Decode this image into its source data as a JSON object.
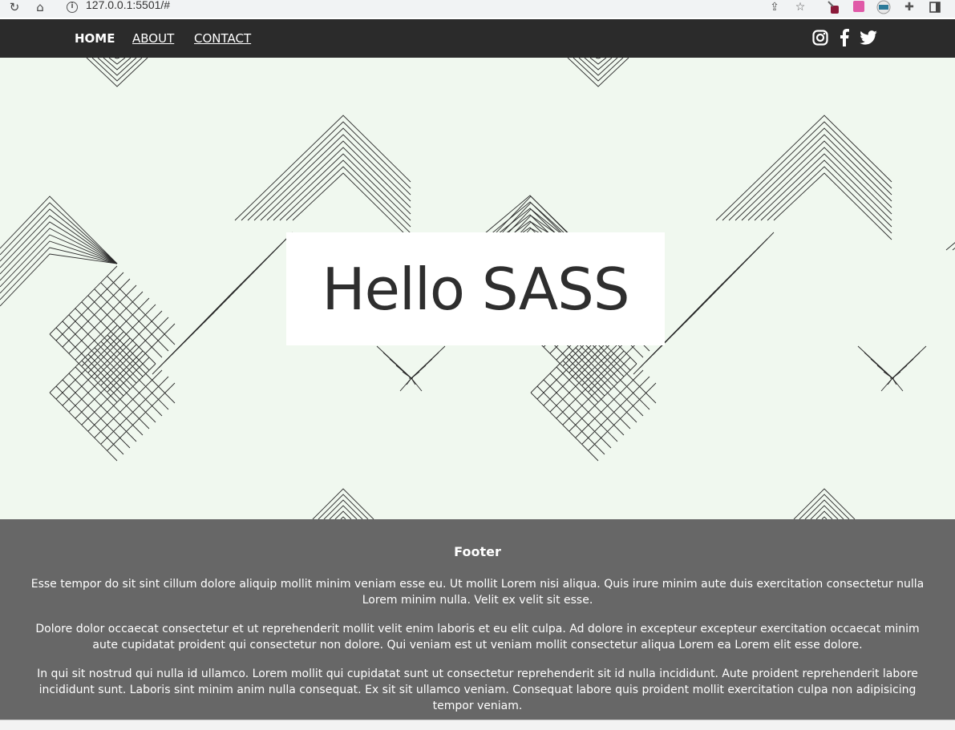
{
  "browser": {
    "url": "127.0.0.1:5501/#",
    "icons": [
      "reload-icon",
      "home-icon",
      "site-info-icon",
      "share-icon",
      "bookmark-star-icon",
      "extension-icon",
      "puzzle-icon",
      "sidebar-icon"
    ]
  },
  "nav": {
    "links": [
      "HOME",
      "ABOUT",
      "CONTACT"
    ],
    "social_icons": [
      "instagram-icon",
      "facebook-icon",
      "twitter-icon"
    ]
  },
  "hero": {
    "title": "Hello SASS",
    "background_color": "#f0f8ef"
  },
  "footer": {
    "heading": "Footer",
    "paragraphs": [
      "Esse tempor do sit sint cillum dolore aliquip mollit minim veniam esse eu. Ut mollit Lorem nisi aliqua. Quis irure minim aute duis exercitation consectetur nulla Lorem minim nulla. Velit ex velit sit esse.",
      "Dolore dolor occaecat consectetur et ut reprehenderit mollit velit enim laboris et eu elit culpa. Ad dolore in excepteur excepteur exercitation occaecat minim aute cupidatat proident qui consectetur non dolore. Qui veniam est ut veniam mollit consectetur aliqua Lorem ea Lorem elit esse dolore.",
      "In qui sit nostrud qui nulla id ullamco. Lorem mollit qui cupidatat sunt ut consectetur reprehenderit sit id nulla incididunt. Aute proident reprehenderit labore incididunt sunt. Laboris sint minim anim nulla consequat. Ex sit sit ullamco veniam. Consequat labore quis proident mollit exercitation culpa non adipisicing tempor veniam."
    ],
    "background_color": "#676767"
  },
  "colors": {
    "nav_bg": "#2b2b2b",
    "text_dark": "#2e2e2e"
  }
}
